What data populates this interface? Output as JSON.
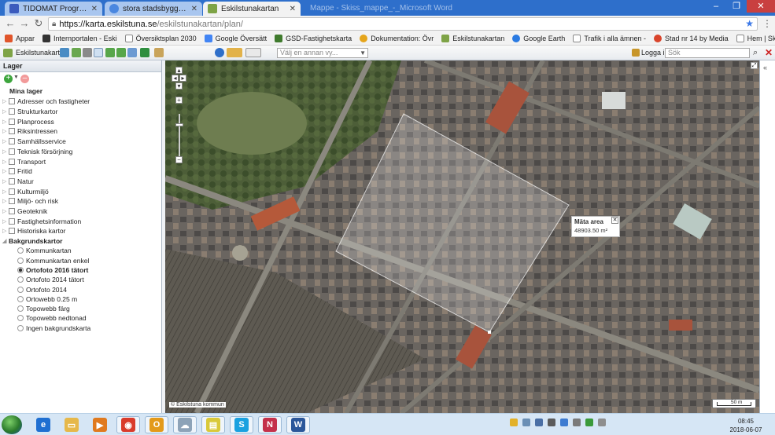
{
  "browser": {
    "tabs": [
      {
        "label": "TIDOMAT Programportal",
        "color": "#3b5bbd"
      },
      {
        "label": "stora stadsbyggnadsproj",
        "color": "#4a87e0"
      },
      {
        "label": "Eskilstunakartan",
        "color": "#7ea346"
      }
    ],
    "ghost_tab": "Mappe - Skiss_mappe_-_Microsoft Word",
    "url_host": "https://karta.eskilstuna.se",
    "url_path": "/eskilstunakartan/plan/",
    "bookmarks": [
      {
        "label": "Appar",
        "color": "#e0552b"
      },
      {
        "label": "Internportalen - Eski",
        "color": "#333333"
      },
      {
        "label": "Översiktsplan 2030",
        "color": "#888888"
      },
      {
        "label": "Google Översätt",
        "color": "#4285f4"
      },
      {
        "label": "GSD-Fastighetskarta",
        "color": "#3f7a2d"
      },
      {
        "label": "Dokumentation: Övr",
        "color": "#e5a51b"
      },
      {
        "label": "Eskilstunakartan",
        "color": "#7ea346"
      },
      {
        "label": "Google Earth",
        "color": "#2a7ae2"
      },
      {
        "label": "Trafik i alla ämnen -",
        "color": "#888888"
      },
      {
        "label": "Stad nr 14 by Media",
        "color": "#d9442b"
      },
      {
        "label": "Hem | Skolhusgrupp",
        "color": "#888888"
      }
    ]
  },
  "app": {
    "name": "Eskilstunakartan",
    "view_placeholder": "Välj en annan vy...",
    "login": "Logga in",
    "search_placeholder": "Sök"
  },
  "layers": {
    "title": "Lager",
    "my_layers": "Mina lager",
    "groups": [
      "Adresser och fastigheter",
      "Strukturkartor",
      "Planprocess",
      "Riksintressen",
      "Samhällsservice",
      "Teknisk försörjning",
      "Transport",
      "Fritid",
      "Natur",
      "Kulturmiljö",
      "Miljö- och risk",
      "Geoteknik",
      "Fastighetsinformation",
      "Historiska kartor"
    ],
    "background_title": "Bakgrundskartor",
    "background_maps": [
      "Kommunkartan",
      "Kommunkartan enkel",
      "Ortofoto 2016 tätort",
      "Ortofoto 2014 tätort",
      "Ortofoto 2014",
      "Ortowebb 0.25 m",
      "Topowebb färg",
      "Topowebb nedtonad",
      "Ingen bakgrundskarta"
    ],
    "background_selected": "Ortofoto 2016 tätort"
  },
  "map": {
    "measure_title": "Mäta area",
    "measure_value": "48903.50 m²",
    "attribution": "© Eskilstuna kommun",
    "scale_label": "50 m"
  },
  "taskbar": {
    "apps": [
      {
        "icon": "internet-explorer-icon",
        "color": "#1f6fd1"
      },
      {
        "icon": "file-explorer-icon",
        "color": "#e6b84a"
      },
      {
        "icon": "media-player-icon",
        "color": "#e07a1f"
      },
      {
        "icon": "chrome-icon",
        "color": "#d93b2b"
      },
      {
        "icon": "outlook-icon",
        "color": "#e39a1a"
      },
      {
        "icon": "network-icon",
        "color": "#8da3b8"
      },
      {
        "icon": "notes-icon",
        "color": "#d9c93a"
      },
      {
        "icon": "skype-icon",
        "color": "#1aa1e0"
      },
      {
        "icon": "onenote-icon",
        "color": "#c4314b"
      },
      {
        "icon": "word-icon",
        "color": "#2b579a"
      }
    ],
    "time": "08:45",
    "date": "2018-06-07"
  }
}
